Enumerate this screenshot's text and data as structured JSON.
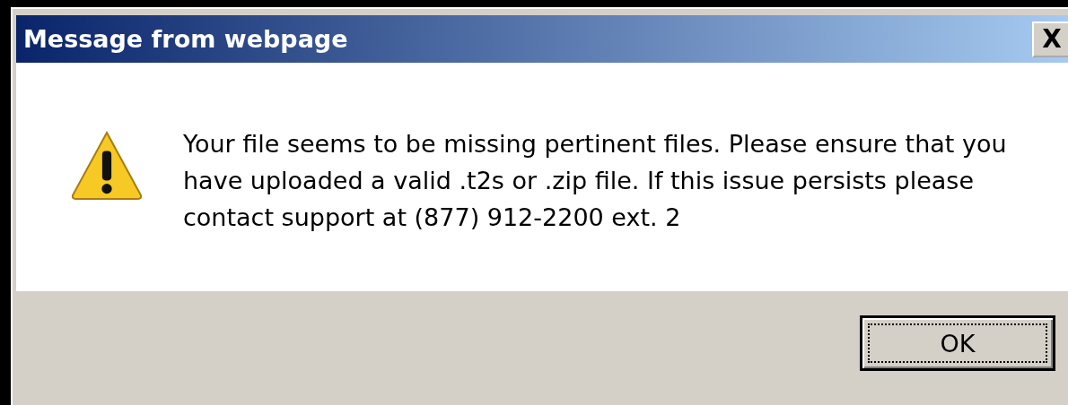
{
  "window": {
    "title": "Message from webpage",
    "close_label": "X"
  },
  "message": {
    "text": "Your file seems to be missing pertinent files. Please ensure that you have uploaded a valid .t2s or .zip file. If this issue persists please contact support at (877) 912-2200 ext. 2"
  },
  "buttons": [
    {
      "label": "OK",
      "focused": true
    }
  ]
}
